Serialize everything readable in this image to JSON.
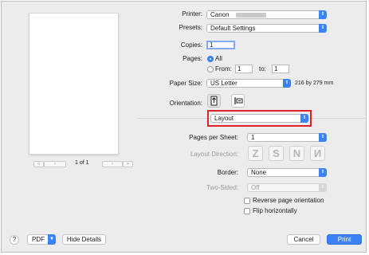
{
  "printer": {
    "label": "Printer:",
    "value": "Canon"
  },
  "presets": {
    "label": "Presets:",
    "value": "Default Settings"
  },
  "copies": {
    "label": "Copies:",
    "value": "1"
  },
  "pages": {
    "label": "Pages:",
    "all_label": "All",
    "from_label": "From:",
    "from_value": "1",
    "to_label": "to:",
    "to_value": "1"
  },
  "paper_size": {
    "label": "Paper Size:",
    "value": "US Letter",
    "dimensions": "216 by 279 mm"
  },
  "orientation": {
    "label": "Orientation:",
    "selected": "portrait"
  },
  "section": {
    "value": "Layout"
  },
  "pages_per_sheet": {
    "label": "Pages per Sheet:",
    "value": "1"
  },
  "layout_direction": {
    "label": "Layout Direction:",
    "glyphs": [
      "Z",
      "S",
      "N",
      "N"
    ]
  },
  "border": {
    "label": "Border:",
    "value": "None"
  },
  "two_sided": {
    "label": "Two-Sided:",
    "value": "Off"
  },
  "reverse_orientation": {
    "label": "Reverse page orientation",
    "checked": false
  },
  "flip_horizontally": {
    "label": "Flip horizontally",
    "checked": false
  },
  "preview": {
    "page_indicator": "1 of 1",
    "first": "«",
    "prev": "‹",
    "next": "›",
    "last": "»"
  },
  "footer": {
    "help": "?",
    "pdf": "PDF",
    "hide_details": "Hide Details",
    "cancel": "Cancel",
    "print": "Print"
  },
  "colors": {
    "accent": "#3b82f6",
    "highlight_border": "#e0212b"
  }
}
